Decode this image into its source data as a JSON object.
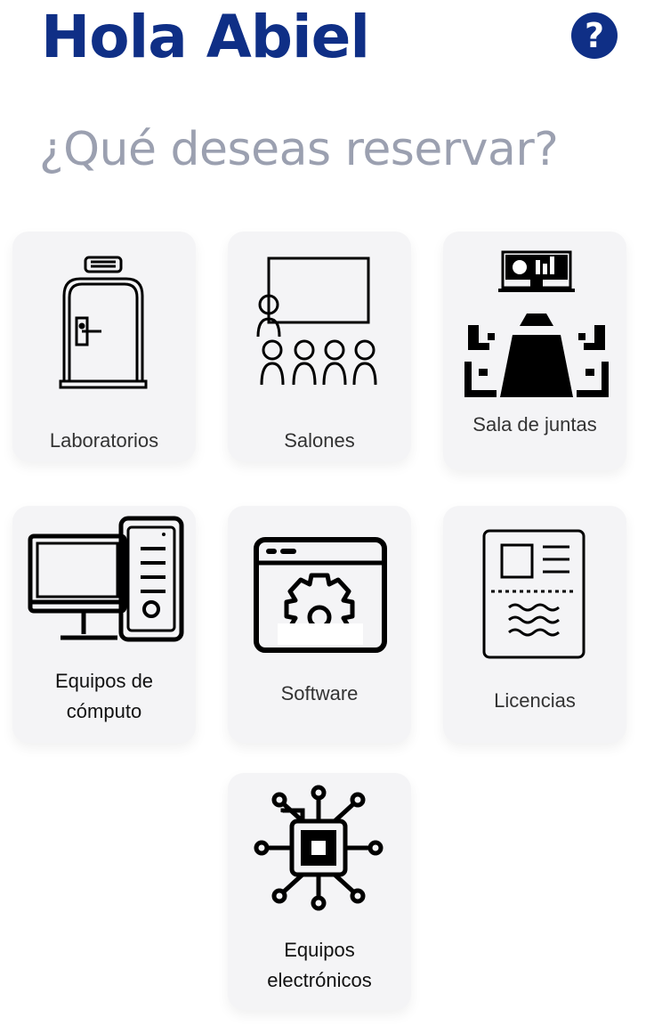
{
  "header": {
    "greeting": "Hola Abiel",
    "help_glyph": "?",
    "help_icon": "question-circle-icon"
  },
  "subtitle": "¿Qué deseas reservar?",
  "colors": {
    "brand": "#0f2f86",
    "subtitle": "#9ba0b0",
    "card_bg": "#f4f4f6"
  },
  "categories": [
    {
      "label": "Laboratorios",
      "icon": "door-icon"
    },
    {
      "label": "Salones",
      "icon": "classroom-icon"
    },
    {
      "label": "Sala de juntas",
      "icon": "meeting-room-icon"
    },
    {
      "label_line1": "Equipos de",
      "label_line2": "cómputo",
      "icon": "desktop-computer-icon"
    },
    {
      "label": "Software",
      "icon": "software-gear-icon"
    },
    {
      "label": "Licencias",
      "icon": "license-document-icon"
    },
    {
      "label_line1": "Equipos",
      "label_line2": "electrónicos",
      "icon": "circuit-chip-icon"
    }
  ]
}
